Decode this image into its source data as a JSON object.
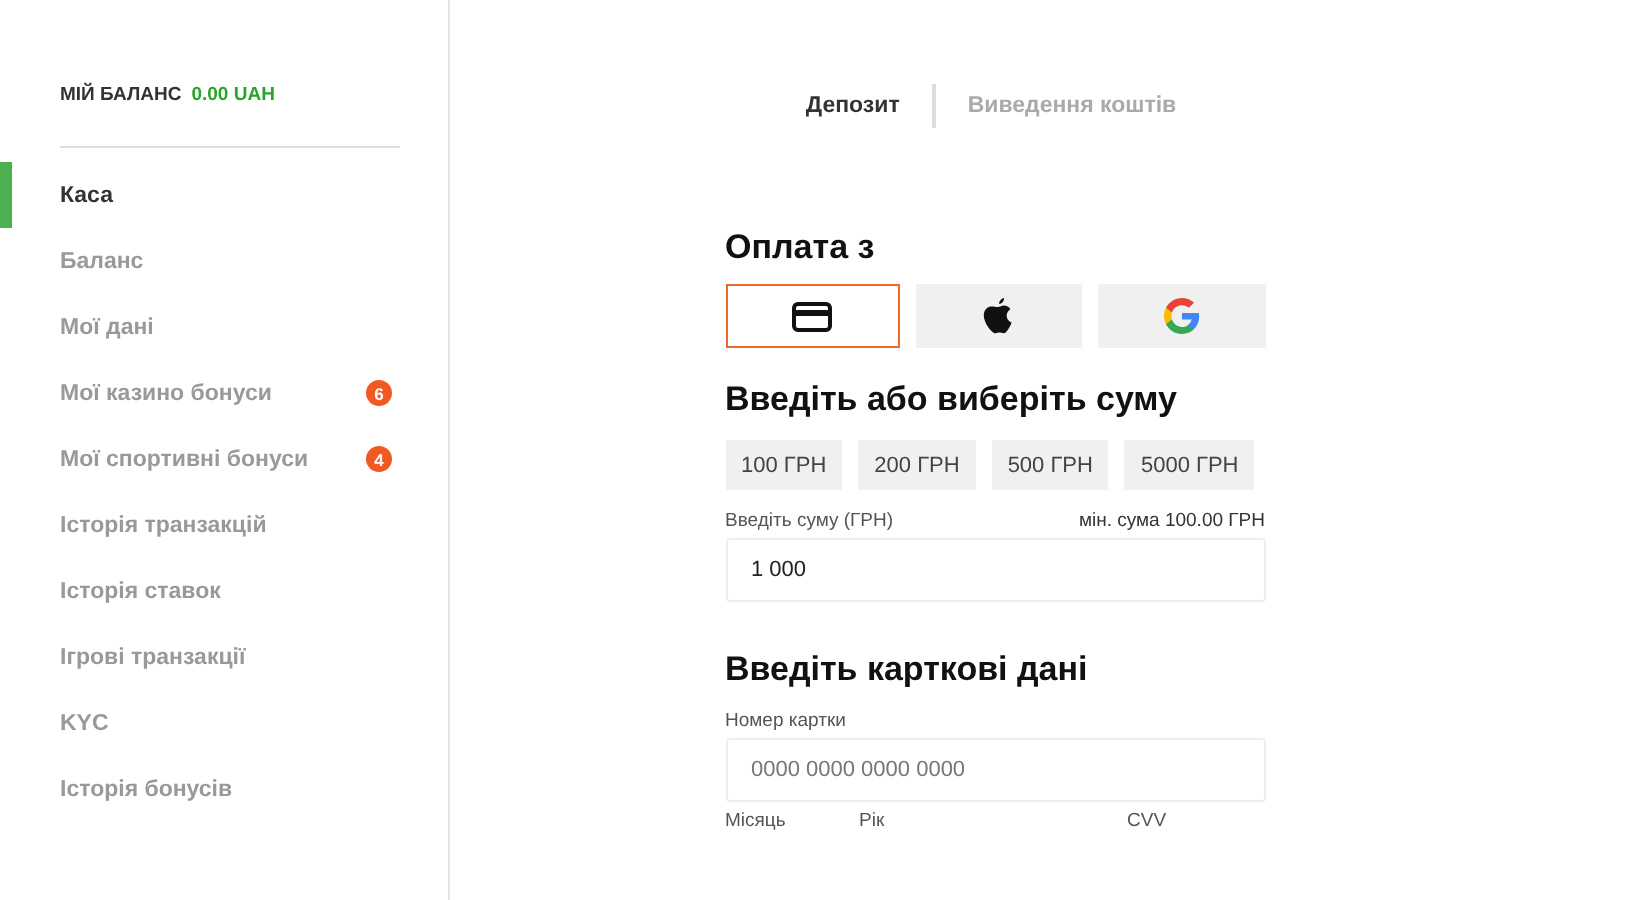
{
  "sidebar": {
    "balance_label": "МІЙ БАЛАНС",
    "balance_value": "0.00 UAH",
    "items": [
      {
        "label": "Каса",
        "selected": true
      },
      {
        "label": "Баланс",
        "selected": false
      },
      {
        "label": "Мої дані",
        "selected": false
      },
      {
        "label": "Мої казино бонуси",
        "selected": false,
        "badge": "6"
      },
      {
        "label": "Мої спортивні бонуси",
        "selected": false,
        "badge": "4"
      },
      {
        "label": "Історія транзакцій",
        "selected": false
      },
      {
        "label": "Історія ставок",
        "selected": false
      },
      {
        "label": "Ігрові транзакції",
        "selected": false
      },
      {
        "label": "KYC",
        "selected": false
      },
      {
        "label": "Історія бонусів",
        "selected": false
      }
    ]
  },
  "tabs": [
    {
      "label": "Депозит",
      "selected": true
    },
    {
      "label": "Виведення коштів",
      "selected": false
    }
  ],
  "payment": {
    "title": "Оплата з",
    "methods": [
      {
        "kind": "card",
        "selected": true
      },
      {
        "kind": "apple",
        "selected": false
      },
      {
        "kind": "google",
        "selected": false
      }
    ]
  },
  "amount": {
    "title": "Введіть або виберіть суму",
    "presets": [
      "100 ГРН",
      "200 ГРН",
      "500 ГРН",
      "5000 ГРН"
    ],
    "label": "Введіть суму (ГРН)",
    "min_note": "мін. сума 100.00 ГРН",
    "value": "1 000"
  },
  "card": {
    "title": "Введіть карткові дані",
    "number_label": "Номер картки",
    "number_placeholder": "0000 0000 0000 0000",
    "month_label": "Місяць",
    "year_label": "Рік",
    "cvv_label": "CVV"
  }
}
